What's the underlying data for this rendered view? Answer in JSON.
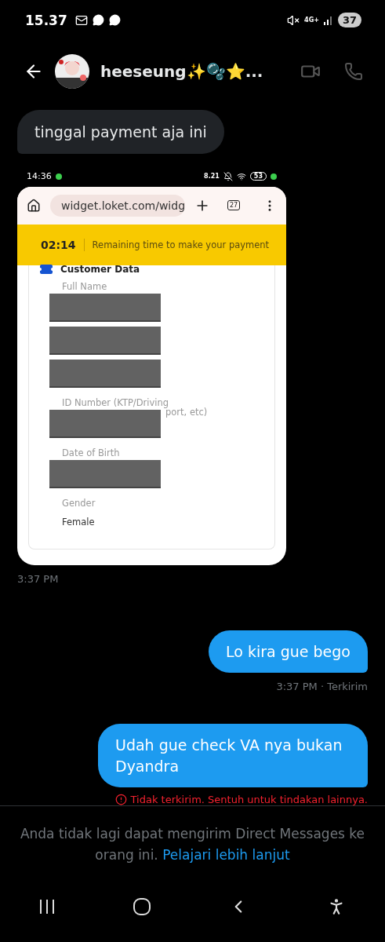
{
  "status_bar": {
    "time": "15.37",
    "network": "4G+",
    "battery": "37"
  },
  "header": {
    "name": "heeseung✨🫧⭐..."
  },
  "messages": [
    {
      "kind": "received",
      "text": "tinggal payment aja ini"
    },
    {
      "time": "3:37 PM",
      "screenshot": {
        "time": "14:36",
        "speed": "8.21",
        "battery": "53",
        "url": "widget.loket.com/widg",
        "tabs": "27",
        "timer": "02:14",
        "timer_text": "Remaining time to make your payment",
        "section": "Customer Data",
        "fields": [
          {
            "label": "Full Name",
            "redacted": true
          },
          {
            "redacted": true
          },
          {
            "redacted": true
          },
          {
            "label": "ID Number (KTP/Driving",
            "redacted": true,
            "tail": "port, etc)"
          },
          {
            "label": "Date of Birth",
            "redacted": true
          },
          {
            "label": "Gender",
            "value": "Female"
          }
        ]
      }
    },
    {
      "kind": "sent",
      "text": "Lo kira gue bego",
      "meta": "3:37 PM · Terkirim",
      "failed": false
    },
    {
      "kind": "sent",
      "text": "Udah gue check VA nya bukan Dyandra",
      "meta": "Tidak terkirim. Sentuh untuk tindakan lainnya.",
      "failed": true
    }
  ],
  "footer": {
    "notice": "Anda tidak lagi dapat mengirim Direct Messages ke orang ini.",
    "link": "Pelajari lebih lanjut"
  }
}
